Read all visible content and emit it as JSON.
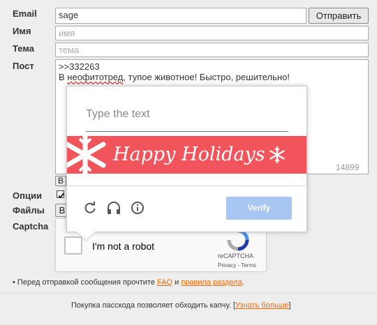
{
  "form": {
    "email_label": "Email",
    "email_value": "sage",
    "submit_label": "Отправить",
    "name_label": "Имя",
    "name_placeholder": "имя",
    "subject_label": "Тема",
    "subject_placeholder": "тема",
    "post_label": "Пост",
    "post_line1": ">>332263",
    "post_line2_a": "В ",
    "post_line2_misspelled": "неофитотред",
    "post_line2_b": ", тупое животное! Быстро, решительно!",
    "char_counter": "14899",
    "bold_button_label": "B",
    "options_label": "Опции",
    "files_label": "Файлы",
    "files_button_label": "В",
    "captcha_label": "Captcha"
  },
  "recaptcha": {
    "checkbox_label": "I'm not a robot",
    "brand": "reCAPTCHA",
    "privacy": "Privacy",
    "terms": "Terms",
    "separator": "-"
  },
  "challenge": {
    "input_placeholder": "Type the text",
    "image_text": "Happy Holidays",
    "verify_label": "Verify",
    "banner_color": "#f2545b"
  },
  "rules": {
    "bullet": "•",
    "text_before": "Перед отправкой сообщения прочтите ",
    "faq_link": "FAQ",
    "and": " и ",
    "rules_link": "правила раздела",
    "text_after": "."
  },
  "footer": {
    "text": "Покупка пасскода позволяет обходить капчу. ",
    "bracket_open": "[",
    "learn_more": "Узнать больше",
    "bracket_close": "]"
  },
  "colors": {
    "link": "#ff6600",
    "verify": "#a7c6f1"
  }
}
